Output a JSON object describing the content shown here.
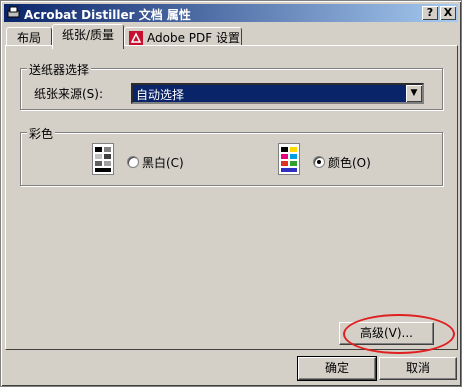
{
  "window": {
    "title": "Acrobat Distiller 文档 属性",
    "help_button": "?",
    "close_button": "X"
  },
  "tabs": [
    {
      "label": "布局"
    },
    {
      "label": "纸张/质量"
    },
    {
      "label": "Adobe PDF 设置",
      "icon": "adobe-pdf-icon"
    }
  ],
  "paper_source_group": {
    "legend": "送纸器选择",
    "source_label": "纸张来源(S):",
    "source_value": "自动选择"
  },
  "color_group": {
    "legend": "彩色",
    "bw_label": "黑白(C)",
    "color_label": "颜色(O)",
    "selected": "color"
  },
  "buttons": {
    "advanced": "高级(V)...",
    "ok": "确定",
    "cancel": "取消"
  },
  "colors": {
    "title_start": "#0a246a",
    "title_end": "#a6caf0",
    "highlight_oval": "#e02020"
  }
}
